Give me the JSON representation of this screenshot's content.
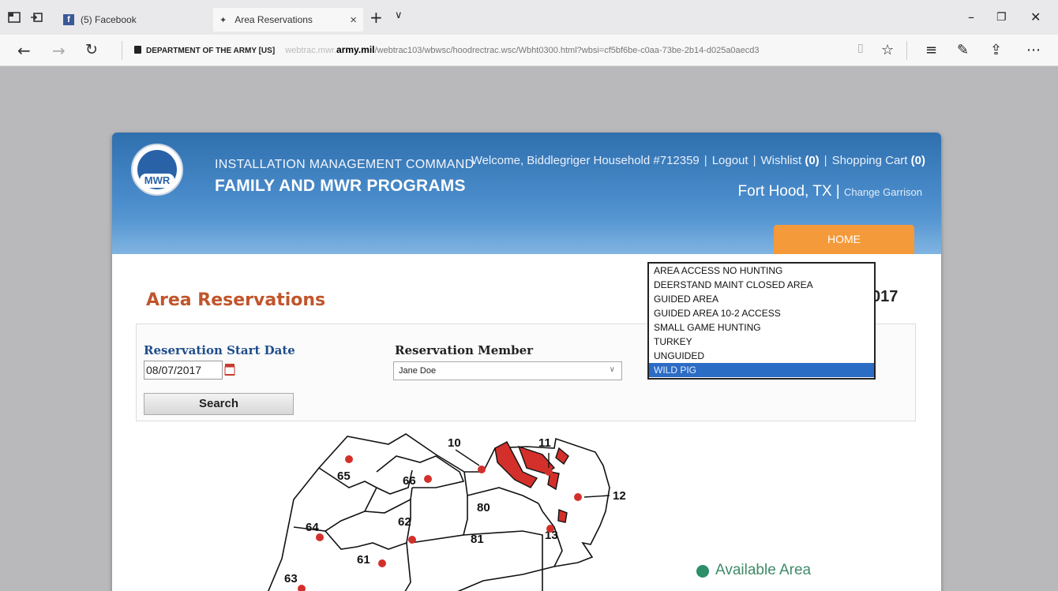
{
  "browser": {
    "tabs": [
      {
        "label": "(5) Facebook"
      },
      {
        "label": "Area Reservations"
      }
    ],
    "url": {
      "org": "DEPARTMENT OF THE ARMY [US]",
      "prefix": "webtrac.mwr.",
      "domain": "army.mil",
      "path": "/webtrac103/wbwsc/hoodrectrac.wsc/Wbht0300.html?wbsi=cf5bf6be-c0aa-73be-2b14-d025a0aecd3"
    }
  },
  "header": {
    "logo_text": "MWR",
    "line1": "INSTALLATION MANAGEMENT COMMAND",
    "line2": "FAMILY AND MWR PROGRAMS",
    "welcome": "Welcome, Biddlegriger Household #712359",
    "logout": "Logout",
    "wishlist": "Wishlist",
    "wishlist_count": "(0)",
    "cart": "Shopping Cart",
    "cart_count": "(0)",
    "garrison": "Fort Hood, TX",
    "change_garrison": "Change Garrison",
    "home_tab": "HOME"
  },
  "page": {
    "title": "Area Reservations",
    "year_fragment": "017"
  },
  "form": {
    "date_label": "Reservation Start Date",
    "date_value": "08/07/2017",
    "member_label": "Reservation Member",
    "member_value": "Jane Doe",
    "search_label": "Search"
  },
  "area_type_options": [
    "AREA ACCESS NO HUNTING",
    "DEERSTAND MAINT CLOSED AREA",
    "GUIDED AREA",
    "GUIDED AREA 10-2 ACCESS",
    "SMALL GAME HUNTING",
    "TURKEY",
    "UNGUIDED",
    "WILD PIG"
  ],
  "selected_area_type": "WILD PIG",
  "map": {
    "area_labels": [
      "10",
      "11",
      "12",
      "13",
      "61",
      "62",
      "63",
      "64",
      "65",
      "66",
      "80",
      "81"
    ],
    "reserved_color": "#d3302b",
    "available_color": "#2c8f6a"
  },
  "legend": {
    "available": "Available Area"
  }
}
